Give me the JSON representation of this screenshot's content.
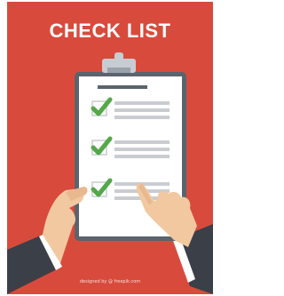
{
  "poster": {
    "title": "CHECK LIST",
    "credit": "designed by @ freepik.com",
    "colors": {
      "background": "#d84b3c",
      "clipboard": "#5b636d",
      "paper": "#ffffff",
      "check": "#55a84a",
      "line": "#c9ccd1",
      "sleeve": "#3b3f47",
      "skin": "#f2c8a0"
    },
    "icons": [
      "clipboard-icon",
      "checkmark-icon",
      "hand-icon"
    ]
  }
}
